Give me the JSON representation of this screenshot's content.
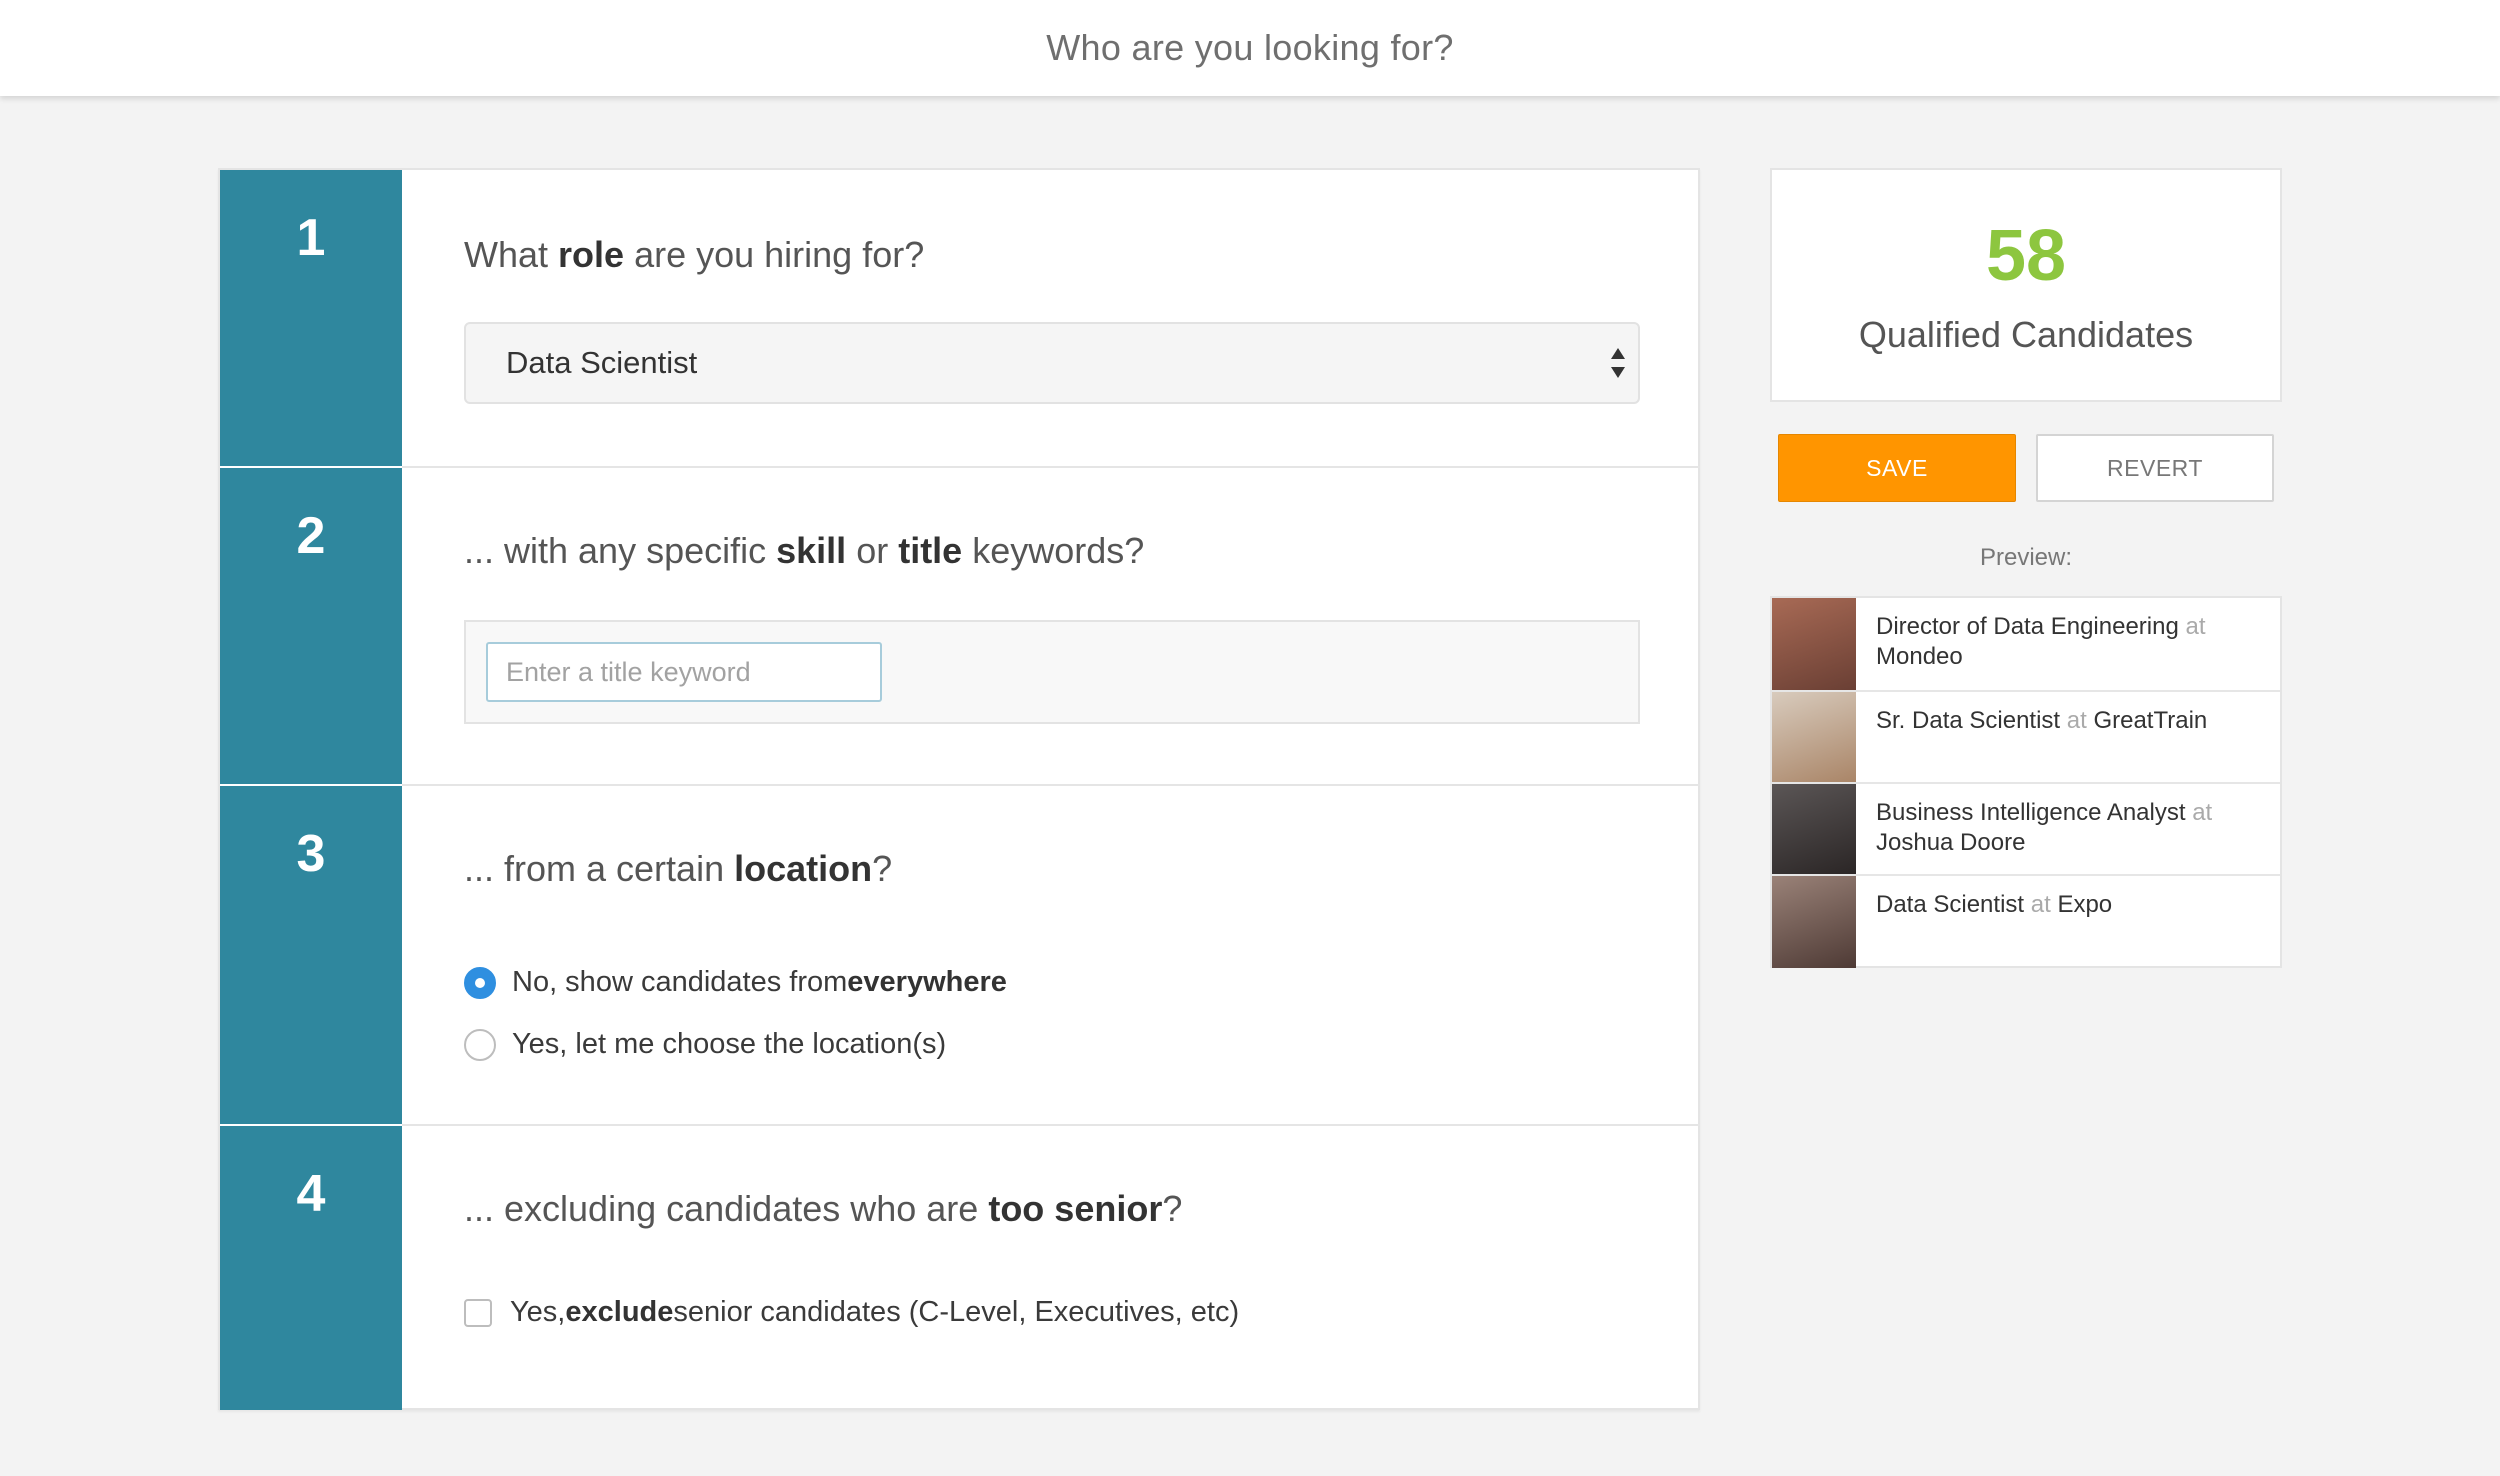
{
  "header": {
    "title": "Who are you looking for?"
  },
  "steps": {
    "role": {
      "number": "1",
      "q_pre": "What ",
      "q_bold": "role",
      "q_post": " are you hiring for?",
      "selected": "Data Scientist"
    },
    "keywords": {
      "number": "2",
      "q_pre": "... with any specific ",
      "q_bold1": "skill",
      "q_mid": " or ",
      "q_bold2": "title",
      "q_post": " keywords?",
      "placeholder": "Enter a title keyword",
      "value": ""
    },
    "location": {
      "number": "3",
      "q_pre": "... from a certain ",
      "q_bold": "location",
      "q_post": "?",
      "options": [
        {
          "pre": "No, show candidates from ",
          "bold": "everywhere",
          "post": "",
          "selected": true
        },
        {
          "pre": "Yes, let me choose the location(s)",
          "bold": "",
          "post": "",
          "selected": false
        }
      ]
    },
    "seniority": {
      "number": "4",
      "q_pre": "... excluding candidates who are ",
      "q_bold": "too senior",
      "q_post": "?",
      "check_pre": "Yes, ",
      "check_bold": "exclude",
      "check_post": " senior candidates (C-Level, Executives, etc)",
      "checked": false
    }
  },
  "summary": {
    "count": "58",
    "count_label": "Qualified Candidates",
    "count_color": "#8dc63f",
    "save_label": "SAVE",
    "revert_label": "REVERT",
    "preview_label": "Preview:"
  },
  "preview": [
    {
      "title": "Director of Data Engineering",
      "at": "at",
      "company": "Mondeo",
      "avatar_color": "#8b5a4a"
    },
    {
      "title": "Sr. Data Scientist",
      "at": "at",
      "company": "GreatTrain",
      "avatar_color": "#b89a80"
    },
    {
      "title": "Business Intelligence Analyst",
      "at": "at",
      "company": "Joshua Doore",
      "avatar_color": "#3d3a3a"
    },
    {
      "title": "Data Scientist",
      "at": "at",
      "company": "Expo",
      "avatar_color": "#6b5650"
    }
  ],
  "colors": {
    "accent": "#2f879e",
    "save": "#ff9500",
    "radio_on": "#2f8fe0"
  }
}
